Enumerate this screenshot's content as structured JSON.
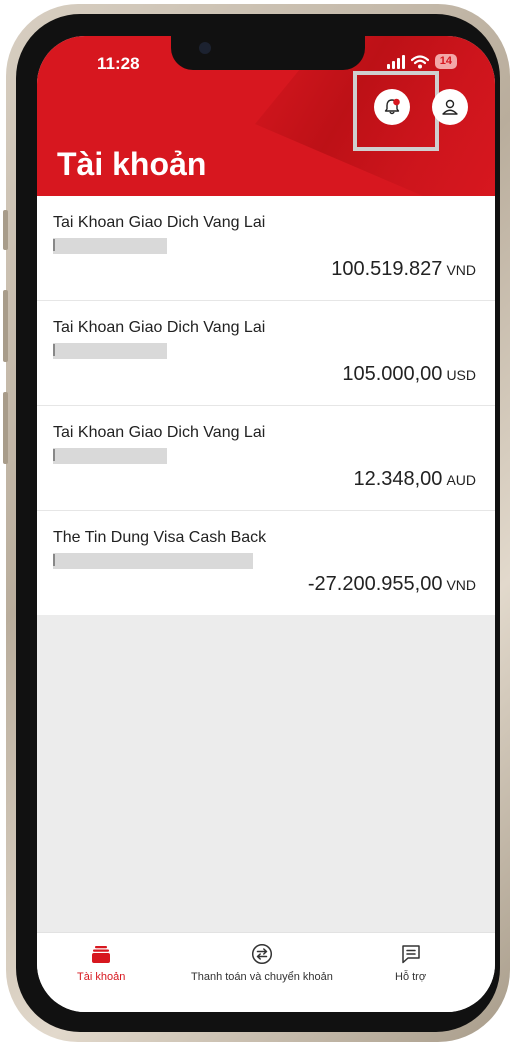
{
  "status_bar": {
    "time": "11:28",
    "battery": "14"
  },
  "header": {
    "title": "Tài khoản"
  },
  "accounts": [
    {
      "name": "Tai Khoan Giao Dich Vang Lai",
      "amount": "100.519.827",
      "currency": "VND"
    },
    {
      "name": "Tai Khoan Giao Dich Vang Lai",
      "amount": "105.000,00",
      "currency": "USD"
    },
    {
      "name": "Tai Khoan Giao Dich Vang Lai",
      "amount": "12.348,00",
      "currency": "AUD"
    },
    {
      "name": "The Tin Dung Visa Cash Back",
      "amount": "-27.200.955,00",
      "currency": "VND"
    }
  ],
  "tabbar": {
    "accounts_label": "Tài khoản",
    "payments_label": "Thanh toán và chuyển khoản",
    "support_label": "Hỗ trợ"
  },
  "colors": {
    "brand_red": "#d7171f",
    "background": "#ececec"
  }
}
